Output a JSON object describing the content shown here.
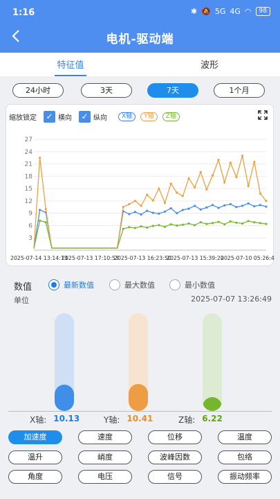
{
  "status": {
    "time": "1:16",
    "net1": "5G",
    "net2": "4G",
    "battery": "98"
  },
  "header": {
    "title": "电机-驱动端"
  },
  "tabs": [
    {
      "label": "特征值"
    },
    {
      "label": "波形"
    }
  ],
  "ranges": [
    {
      "label": "24小时"
    },
    {
      "label": "3天"
    },
    {
      "label": "7天"
    },
    {
      "label": "1个月"
    }
  ],
  "chart_controls": {
    "zoom_lock": "缩放锁定",
    "horizontal": "横向",
    "vertical": "纵向",
    "x_badge": "X轴",
    "y_badge": "Y轴",
    "z_badge": "Z轴"
  },
  "chart_data": {
    "type": "line",
    "yticks": [
      "3",
      "6",
      "9",
      "12",
      "15",
      "18",
      "21",
      "24",
      "27"
    ],
    "ylim": [
      0,
      27
    ],
    "xtick_labels": [
      "2025-07-14 13:14:13",
      "2025-07-13 17:10:53",
      "2025-07-13 16:23:50",
      "2025-07-13 15:39:20",
      "2025-07-10 05:26:49"
    ],
    "series": [
      {
        "name": "X轴",
        "color": "#4a8fe6",
        "values": [
          0.4,
          9.8,
          9.2,
          0.5,
          0.5,
          0.5,
          0.5,
          0.5,
          0.5,
          0.5,
          0.5,
          0.5,
          0.5,
          0.5,
          0.5,
          9.5,
          8.8,
          9.3,
          8.7,
          9.6,
          9.1,
          8.9,
          9.4,
          10.2,
          9.0,
          9.8,
          10.1,
          10.8,
          9.9,
          10.4,
          11.0,
          10.3,
          10.9,
          11.2,
          10.5,
          10.8,
          11.4,
          10.7,
          11.0,
          10.6
        ]
      },
      {
        "name": "Y轴",
        "color": "#f0a040",
        "values": [
          0.4,
          22.5,
          10.0,
          0.5,
          0.5,
          0.5,
          0.5,
          0.5,
          0.5,
          0.5,
          0.5,
          0.5,
          0.5,
          0.5,
          0.5,
          10.5,
          11.2,
          12.0,
          10.8,
          13.5,
          12.1,
          15.0,
          11.5,
          16.2,
          14.0,
          13.2,
          17.5,
          15.3,
          19.0,
          14.8,
          18.2,
          22.0,
          16.5,
          21.3,
          17.8,
          23.0,
          15.6,
          21.5,
          13.8,
          12.0
        ]
      },
      {
        "name": "Z轴",
        "color": "#7ab830",
        "values": [
          0.4,
          7.2,
          6.8,
          0.5,
          0.5,
          0.5,
          0.5,
          0.5,
          0.5,
          0.5,
          0.5,
          0.5,
          0.5,
          0.5,
          0.5,
          5.2,
          5.6,
          5.4,
          5.8,
          5.5,
          5.9,
          6.1,
          5.7,
          6.3,
          6.0,
          6.2,
          6.5,
          6.1,
          6.8,
          6.4,
          6.6,
          6.9,
          6.3,
          7.0,
          6.7,
          6.5,
          7.1,
          6.8,
          6.6,
          6.4
        ]
      }
    ]
  },
  "values_section": {
    "label": "数值",
    "options": [
      {
        "label": "最新数值",
        "selected": true
      },
      {
        "label": "最大数值",
        "selected": false
      },
      {
        "label": "最小数值",
        "selected": false
      }
    ],
    "unit": "单位",
    "timestamp": "2025-07-07 13:26:49"
  },
  "gauges": [
    {
      "axis": "X轴:",
      "value": "10.13",
      "level": 0.27,
      "color": "#3f8fe8",
      "track": "#cfe0f5",
      "text_color": "#1f7de6"
    },
    {
      "axis": "Y轴:",
      "value": "10.41",
      "level": 0.28,
      "color": "#ef9d45",
      "track": "#f6e4d1",
      "text_color": "#e88f2a"
    },
    {
      "axis": "Z轴:",
      "value": "6.22",
      "level": 0.14,
      "color": "#76b62d",
      "track": "#dcebd1",
      "text_color": "#5fa41c"
    }
  ],
  "metrics": [
    {
      "label": "加速度",
      "active": true
    },
    {
      "label": "速度",
      "active": false
    },
    {
      "label": "位移",
      "active": false
    },
    {
      "label": "温度",
      "active": false
    },
    {
      "label": "温升",
      "active": false
    },
    {
      "label": "峭度",
      "active": false
    },
    {
      "label": "波峰因数",
      "active": false
    },
    {
      "label": "包络",
      "active": false
    },
    {
      "label": "角度",
      "active": false
    },
    {
      "label": "电压",
      "active": false
    },
    {
      "label": "信号",
      "active": false
    },
    {
      "label": "振动频率",
      "active": false
    }
  ]
}
